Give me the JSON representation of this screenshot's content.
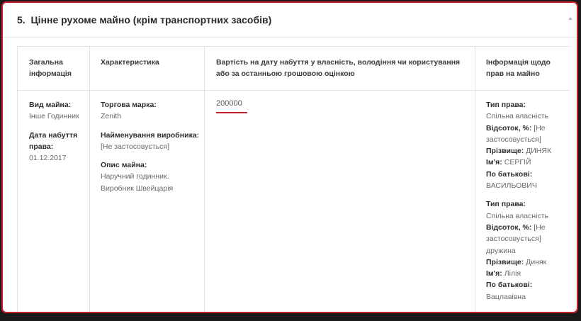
{
  "section": {
    "title": "5.  Цінне рухоме майно (крім транспортних засобів)"
  },
  "table": {
    "headers": [
      "Загальна інформація",
      "Характеристика",
      "Вартість на дату набуття у власність, володіння чи користування або за останньою грошовою оцінкою",
      "Інформація щодо прав на майно"
    ],
    "general": {
      "type_label": "Вид майна:",
      "type_value": "Інше Годинник",
      "date_label": "Дата набуття права:",
      "date_value": "01.12.2017"
    },
    "characteristics": {
      "brand_label": "Торгова марка:",
      "brand_value": "Zenith",
      "maker_label": "Найменування виробника:",
      "maker_value": "[Не застосовується]",
      "desc_label": "Опис майна:",
      "desc_value": "Наручний годинник. Виробник Швейцарія"
    },
    "price": "200000",
    "rights": [
      {
        "type_label": "Тип права:",
        "type_value": "Спільна власність",
        "share_label": "Відсоток, %:",
        "share_value": "[Не застосовується]",
        "relation": "",
        "surname_label": "Прізвище:",
        "surname_value": "ДИНЯК",
        "name_label": "Ім'я:",
        "name_value": "СЕРГІЙ",
        "patronymic_label": "По батькові:",
        "patronymic_value": "ВАСИЛЬОВИЧ"
      },
      {
        "type_label": "Тип права:",
        "type_value": "Спільна власність",
        "share_label": "Відсоток, %:",
        "share_value": "[Не застосовується]",
        "relation": "дружина",
        "surname_label": "Прізвище:",
        "surname_value": "Диняк",
        "name_label": "Ім'я:",
        "name_value": "Лілія",
        "patronymic_label": "По батькові:",
        "patronymic_value": "Вацлавівна"
      }
    ]
  },
  "colors": {
    "accent": "#c8202a",
    "border": "#e3e3e3"
  }
}
